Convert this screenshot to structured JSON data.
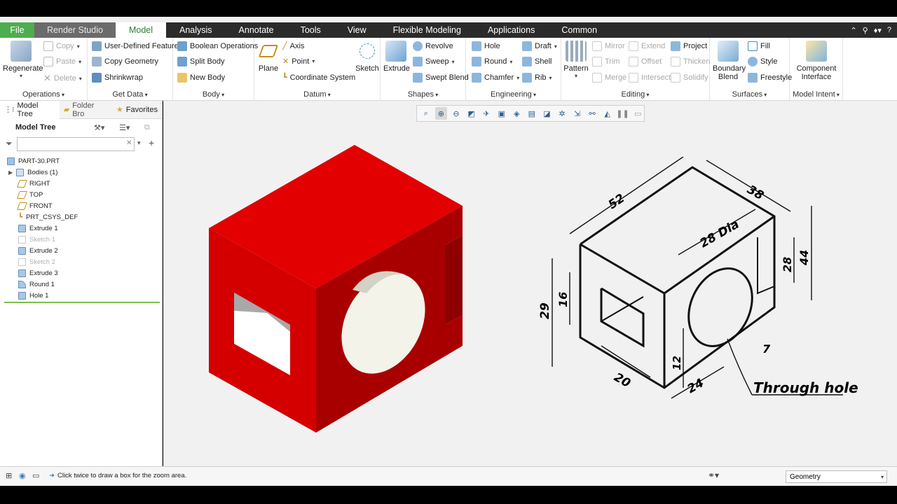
{
  "tabs": {
    "file": "File",
    "render_studio": "Render Studio",
    "model": "Model",
    "analysis": "Analysis",
    "annotate": "Annotate",
    "tools": "Tools",
    "view": "View",
    "flexible_modeling": "Flexible Modeling",
    "applications": "Applications",
    "common": "Common"
  },
  "ribbon": {
    "operations": {
      "label": "Operations",
      "regenerate": "Regenerate",
      "copy": "Copy",
      "paste": "Paste",
      "delete": "Delete"
    },
    "get_data": {
      "label": "Get Data",
      "user_defined_feature": "User-Defined Feature",
      "copy_geometry": "Copy Geometry",
      "shrinkwrap": "Shrinkwrap"
    },
    "body": {
      "label": "Body",
      "boolean_operations": "Boolean Operations",
      "split_body": "Split Body",
      "new_body": "New Body"
    },
    "datum": {
      "label": "Datum",
      "plane": "Plane",
      "axis": "Axis",
      "point": "Point",
      "coordinate_system": "Coordinate System",
      "sketch": "Sketch"
    },
    "shapes": {
      "label": "Shapes",
      "extrude": "Extrude",
      "revolve": "Revolve",
      "sweep": "Sweep",
      "swept_blend": "Swept Blend"
    },
    "engineering": {
      "label": "Engineering",
      "hole": "Hole",
      "round": "Round",
      "chamfer": "Chamfer",
      "draft": "Draft",
      "shell": "Shell",
      "rib": "Rib"
    },
    "editing": {
      "label": "Editing",
      "pattern": "Pattern",
      "mirror": "Mirror",
      "trim": "Trim",
      "merge": "Merge",
      "extend": "Extend",
      "offset": "Offset",
      "intersect": "Intersect",
      "project": "Project",
      "thicken": "Thicken",
      "solidify": "Solidify"
    },
    "surfaces": {
      "label": "Surfaces",
      "boundary_blend_1": "Boundary",
      "boundary_blend_2": "Blend",
      "fill": "Fill",
      "style": "Style",
      "freestyle": "Freestyle"
    },
    "model_intent": {
      "label": "Model Intent",
      "component_interface_1": "Component",
      "component_interface_2": "Interface"
    }
  },
  "left_panel": {
    "tabs": [
      "Model Tree",
      "Folder Bro",
      "Favorites"
    ],
    "header": "Model Tree",
    "search_placeholder": "",
    "tree": [
      {
        "label": "PART-30.PRT",
        "dim": false
      },
      {
        "label": "Bodies (1)",
        "dim": false
      },
      {
        "label": "RIGHT",
        "dim": false
      },
      {
        "label": "TOP",
        "dim": false
      },
      {
        "label": "FRONT",
        "dim": false
      },
      {
        "label": "PRT_CSYS_DEF",
        "dim": false
      },
      {
        "label": "Extrude 1",
        "dim": false
      },
      {
        "label": "Sketch 1",
        "dim": true
      },
      {
        "label": "Extrude 2",
        "dim": false
      },
      {
        "label": "Sketch 2",
        "dim": true
      },
      {
        "label": "Extrude 3",
        "dim": false
      },
      {
        "label": "Round 1",
        "dim": false
      },
      {
        "label": "Hole 1",
        "dim": false
      }
    ]
  },
  "drawing": {
    "dims": [
      "52",
      "38",
      "28 Dia",
      "29",
      "16",
      "28",
      "44",
      "20",
      "12",
      "24",
      "7"
    ],
    "note": "Through hole"
  },
  "status": {
    "message": "Click twice to draw a box for the zoom area.",
    "filter": "Geometry"
  },
  "colors": {
    "accent_green": "#4cae4c",
    "part_red": "#cc0000"
  }
}
